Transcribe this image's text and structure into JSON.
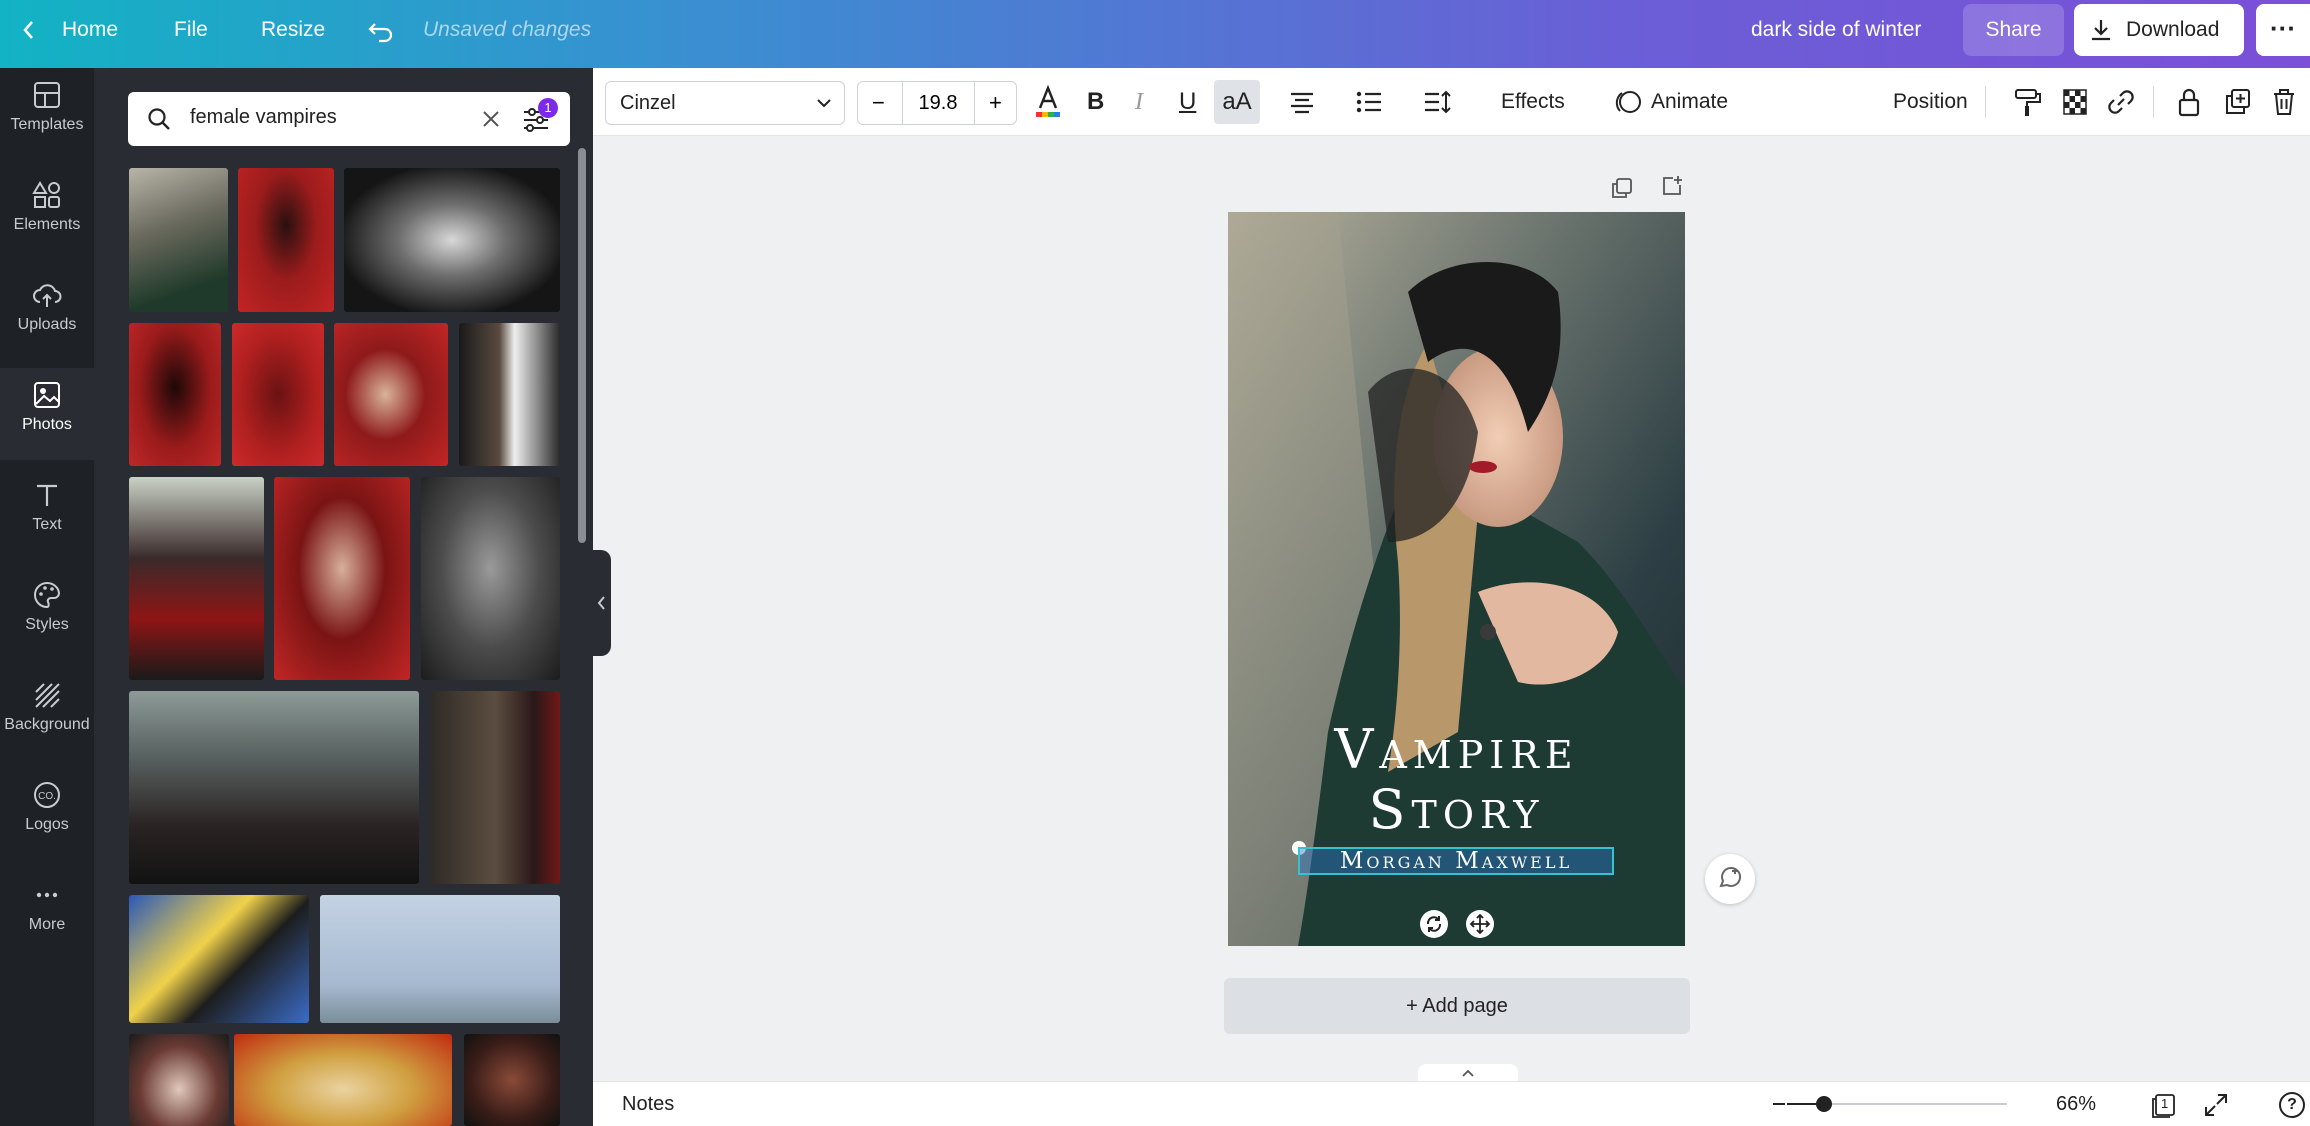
{
  "topbar": {
    "home_label": "Home",
    "file_label": "File",
    "resize_label": "Resize",
    "unsaved_label": "Unsaved changes",
    "doc_title": "dark side of winter",
    "share_label": "Share",
    "download_label": "Download"
  },
  "rail": {
    "items": [
      {
        "label": "Templates",
        "icon": "templates-icon"
      },
      {
        "label": "Elements",
        "icon": "elements-icon"
      },
      {
        "label": "Uploads",
        "icon": "uploads-icon"
      },
      {
        "label": "Photos",
        "icon": "photos-icon"
      },
      {
        "label": "Text",
        "icon": "text-icon"
      },
      {
        "label": "Styles",
        "icon": "styles-icon"
      },
      {
        "label": "Background",
        "icon": "background-icon"
      },
      {
        "label": "Logos",
        "icon": "logos-icon"
      },
      {
        "label": "More",
        "icon": "more-icon"
      }
    ],
    "active": "Photos"
  },
  "search": {
    "value": "female vampires",
    "filter_badge": "1"
  },
  "toolbar": {
    "font": "Cinzel",
    "font_size": "19.8",
    "minus": "−",
    "plus": "+",
    "bold": "B",
    "italic": "I",
    "underline": "U",
    "case": "aA",
    "effects_label": "Effects",
    "animate_label": "Animate",
    "position_label": "Position"
  },
  "design": {
    "title_line1": "Vampire",
    "title_line2": "Story",
    "author": "Morgan Maxwell"
  },
  "canvas": {
    "add_page_label": "+ Add page"
  },
  "bottombar": {
    "notes_label": "Notes",
    "zoom": "66%",
    "page_count": "1",
    "help": "?",
    "zoom_level": 0.17
  },
  "colors": {
    "accent": "#7d2ae8",
    "selection": "#35c3d0"
  }
}
